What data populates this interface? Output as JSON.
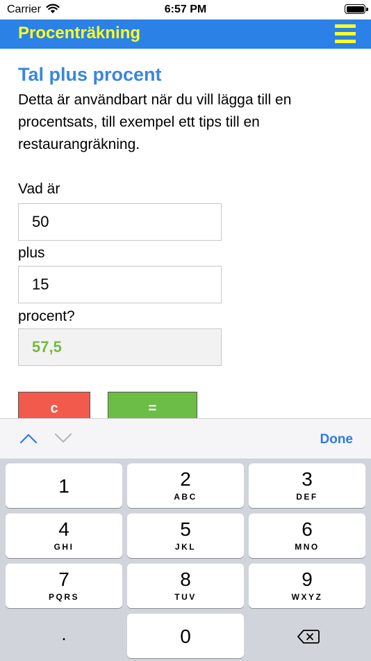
{
  "status": {
    "carrier": "Carrier",
    "time": "6:57 PM"
  },
  "navbar": {
    "title": "Procenträkning",
    "menu_icon": "hamburger-menu-icon",
    "title_color": "#ffff22",
    "bg_color": "#2b81e6"
  },
  "content": {
    "heading": "Tal plus procent",
    "description": "Detta är användbart när du vill lägga till en procentsats, till exempel ett tips till en restaurangräkning.",
    "label_what": "Vad är",
    "value_base": "50",
    "label_plus": "plus",
    "value_percent": "15",
    "label_percent": "procent?",
    "value_result": "57,5",
    "clear_label": "c",
    "equals_label": "="
  },
  "accessory": {
    "done_label": "Done"
  },
  "keypad": {
    "keys": [
      {
        "num": "1",
        "sub": ""
      },
      {
        "num": "2",
        "sub": "ABC"
      },
      {
        "num": "3",
        "sub": "DEF"
      },
      {
        "num": "4",
        "sub": "GHI"
      },
      {
        "num": "5",
        "sub": "JKL"
      },
      {
        "num": "6",
        "sub": "MNO"
      },
      {
        "num": "7",
        "sub": "PQRS"
      },
      {
        "num": "8",
        "sub": "TUV"
      },
      {
        "num": "9",
        "sub": "WXYZ"
      }
    ],
    "dot": ".",
    "zero": "0"
  }
}
